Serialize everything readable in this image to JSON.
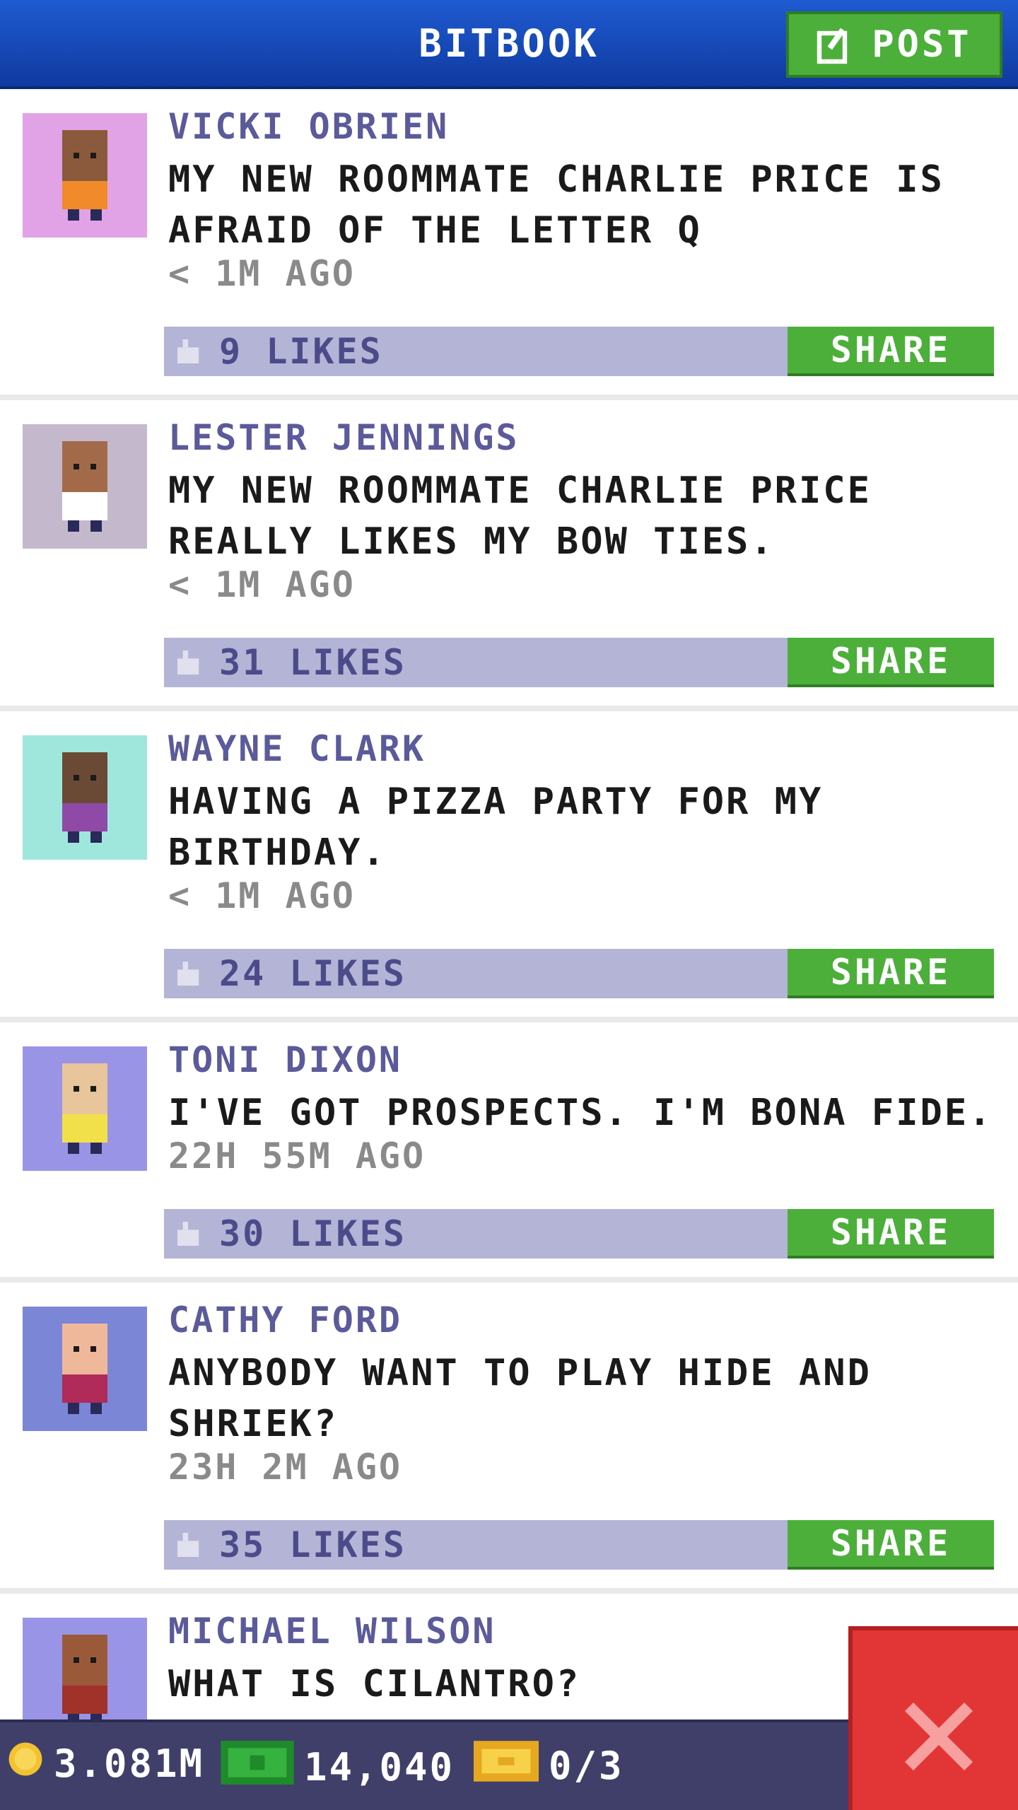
{
  "header": {
    "title": "BITBOOK",
    "post_label": "POST"
  },
  "posts": [
    {
      "name": "VICKI OBRIEN",
      "message": "MY NEW ROOMMATE CHARLIE PRICE IS AFRAID OF THE LETTER Q",
      "time": "< 1M AGO",
      "likes": "9 LIKES",
      "share": "SHARE",
      "avatar_bg": "#e1a3e6",
      "skin": "#8b5a3c",
      "shirt": "#f08a2a"
    },
    {
      "name": "LESTER JENNINGS",
      "message": "MY NEW ROOMMATE CHARLIE PRICE REALLY LIKES MY BOW TIES.",
      "time": "< 1M AGO",
      "likes": "31 LIKES",
      "share": "SHARE",
      "avatar_bg": "#c4b9cc",
      "skin": "#a36a4a",
      "shirt": "#ffffff"
    },
    {
      "name": "WAYNE CLARK",
      "message": "HAVING A PIZZA PARTY FOR MY BIRTHDAY.",
      "time": "< 1M AGO",
      "likes": "24 LIKES",
      "share": "SHARE",
      "avatar_bg": "#9fe7dd",
      "skin": "#6b4a35",
      "shirt": "#8e4aa6"
    },
    {
      "name": "TONI DIXON",
      "message": "I'VE GOT PROSPECTS. I'M BONA FIDE.",
      "time": "22H 55M AGO",
      "likes": "30 LIKES",
      "share": "SHARE",
      "avatar_bg": "#9a94e6",
      "skin": "#e8c59a",
      "shirt": "#f2e04a"
    },
    {
      "name": "CATHY FORD",
      "message": "ANYBODY WANT TO PLAY HIDE AND SHRIEK?",
      "time": "23H 2M AGO",
      "likes": "35 LIKES",
      "share": "SHARE",
      "avatar_bg": "#7b86d6",
      "skin": "#f0b89a",
      "shirt": "#b02a5a"
    },
    {
      "name": "MICHAEL WILSON",
      "message": "WHAT IS CILANTRO?",
      "avatar_bg": "#9a94e6",
      "skin": "#9a5a3a",
      "shirt": "#a0322a"
    }
  ],
  "status": {
    "coins": "3.081M",
    "bux": "14,040",
    "tickets": "0/3"
  },
  "colors": {
    "header": "#1f5bd1",
    "accent_green": "#4caf3a",
    "name_purple": "#5b5a9a",
    "like_bar": "#b4b4d6",
    "close_red": "#e23636"
  },
  "icons": {
    "post": "edit-icon",
    "like": "thumbs-up-icon",
    "coin": "coin-icon",
    "bux": "bux-icon",
    "ticket": "ticket-icon",
    "close": "close-icon"
  }
}
